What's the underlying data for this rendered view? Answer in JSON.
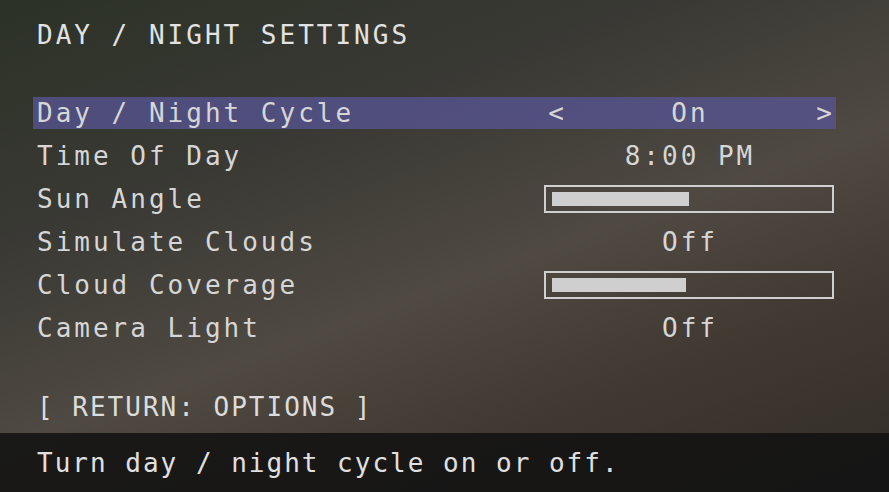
{
  "title": "DAY / NIGHT SETTINGS",
  "arrows": {
    "left": "<",
    "right": ">"
  },
  "settings": [
    {
      "label": "Day / Night Cycle",
      "kind": "choice",
      "value": "On",
      "selected": true
    },
    {
      "label": "Time Of Day",
      "kind": "choice",
      "value": "8:00 PM",
      "selected": false
    },
    {
      "label": "Sun Angle",
      "kind": "slider",
      "level": 0.5,
      "selected": false
    },
    {
      "label": "Simulate Clouds",
      "kind": "choice",
      "value": "Off",
      "selected": false
    },
    {
      "label": "Cloud Coverage",
      "kind": "slider",
      "level": 0.49,
      "selected": false
    },
    {
      "label": "Camera Light",
      "kind": "choice",
      "value": "Off",
      "selected": false
    }
  ],
  "return": "[ RETURN: OPTIONS ]",
  "help": "Turn day / night cycle on or off."
}
